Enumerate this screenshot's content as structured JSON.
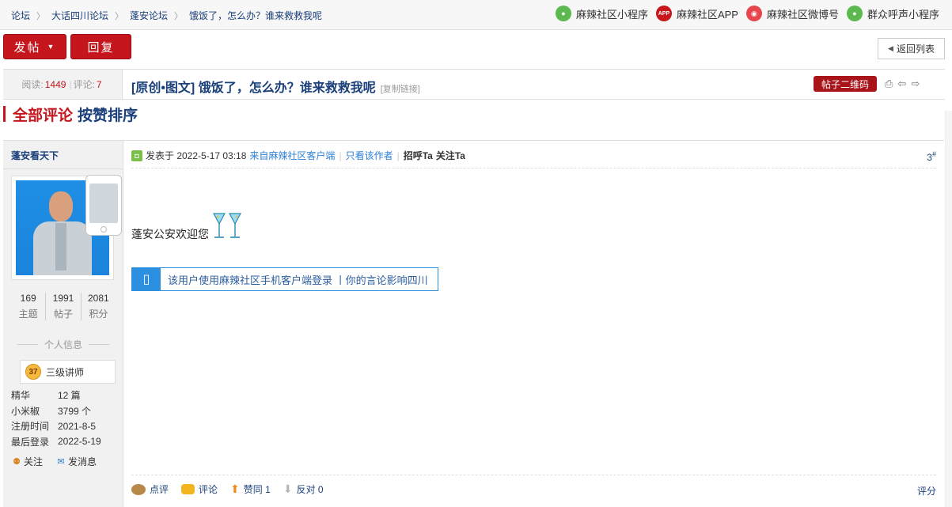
{
  "breadcrumb": [
    "论坛",
    "大话四川论坛",
    "蓬安论坛",
    "饿饭了，怎么办？谁来救救我呢"
  ],
  "top_links": [
    {
      "label": "麻辣社区小程序",
      "icon": "wechat-icon"
    },
    {
      "label": "麻辣社区APP",
      "icon": "app-icon",
      "icon_text": "APP"
    },
    {
      "label": "麻辣社区微博号",
      "icon": "weibo-icon"
    },
    {
      "label": "群众呼声小程序",
      "icon": "wechat-icon"
    }
  ],
  "actions": {
    "post": "发帖",
    "reply": "回复",
    "back": "返回列表"
  },
  "thread": {
    "views_label": "阅读:",
    "views": "1449",
    "comments_label": "评论:",
    "comments": "7",
    "title": "[原创•图文] 饿饭了，怎么办？谁来救救我呢",
    "copy_link": "[复制链接]",
    "qr_button": "帖子二维码"
  },
  "section": {
    "all": "全部评论",
    "sort": "按赞排序"
  },
  "author": {
    "name": "蓬安看天下",
    "stats": [
      {
        "value": "169",
        "label": "主题"
      },
      {
        "value": "1991",
        "label": "帖子"
      },
      {
        "value": "2081",
        "label": "积分"
      }
    ],
    "personal_info_label": "个人信息",
    "rank_level": "37",
    "rank": "三级讲师",
    "facts": [
      {
        "key": "精华",
        "value": "12 篇"
      },
      {
        "key": "小米椒",
        "value": "3799 个"
      },
      {
        "key": "注册时间",
        "value": "2021-8-5"
      },
      {
        "key": "最后登录",
        "value": "2022-5-19"
      }
    ],
    "follow": "关注",
    "message": "发消息"
  },
  "post": {
    "posted_at": "发表于 2022-5-17 03:18",
    "source": "来自麻辣社区客户端",
    "only_author": "只看该作者",
    "greet": "招呼Ta",
    "follow": "关注Ta",
    "floor": "3",
    "floor_sup": "#",
    "content": "蓬安公安欢迎您",
    "mobile_notice": "该用户使用麻辣社区手机客户端登录 丨你的言论影响四川",
    "comment_point": "点评",
    "comment": "评论",
    "agree": "赞同",
    "agree_count": "1",
    "oppose": "反对",
    "oppose_count": "0",
    "rate": "评分"
  },
  "colors": {
    "brand_red": "#c4161c",
    "link_blue": "#1a3f7a",
    "mobile_blue": "#2c8fe0"
  }
}
